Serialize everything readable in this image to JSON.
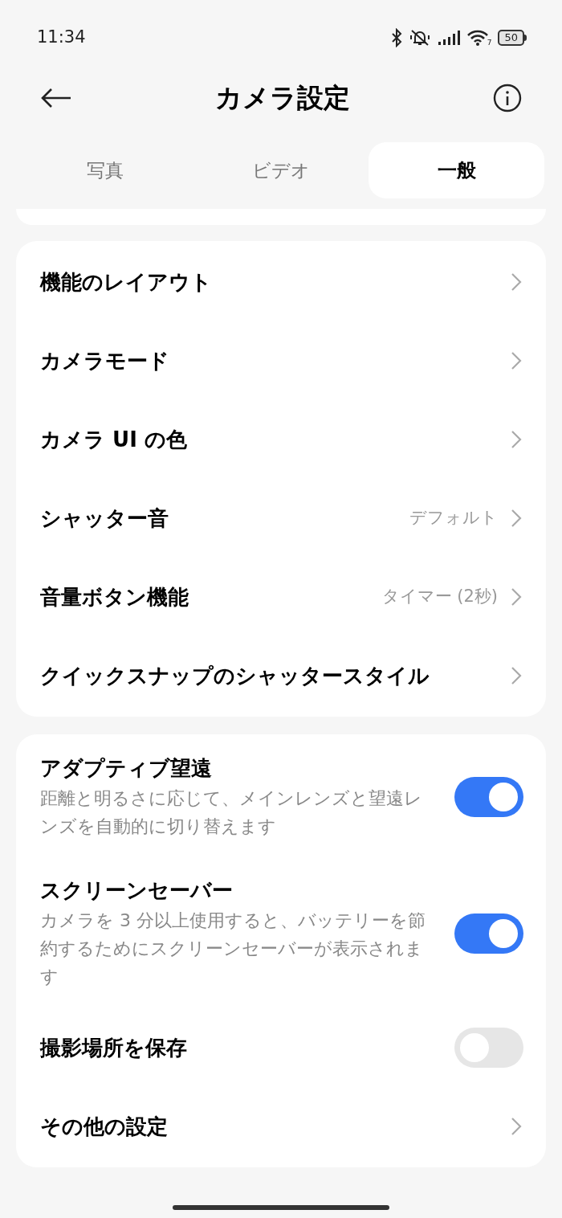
{
  "status_bar": {
    "time": "11:34",
    "wifi_badge": "7",
    "battery": "50"
  },
  "header": {
    "title": "カメラ設定"
  },
  "tabs": [
    {
      "label": "写真",
      "selected": false
    },
    {
      "label": "ビデオ",
      "selected": false
    },
    {
      "label": "一般",
      "selected": true
    }
  ],
  "groups": [
    {
      "items": [
        {
          "kind": "link",
          "label": "機能のレイアウト"
        },
        {
          "kind": "link",
          "label": "カメラモード"
        },
        {
          "kind": "link",
          "label": "カメラ UI の色"
        },
        {
          "kind": "link",
          "label": "シャッター音",
          "value": "デフォルト"
        },
        {
          "kind": "link",
          "label": "音量ボタン機能",
          "value": "タイマー (2秒)"
        },
        {
          "kind": "link",
          "label": "クイックスナップのシャッタースタイル"
        }
      ]
    },
    {
      "items": [
        {
          "kind": "toggle",
          "label": "アダプティブ望遠",
          "description": "距離と明るさに応じて、メインレンズと望遠レンズを自動的に切り替えます",
          "on": true
        },
        {
          "kind": "toggle",
          "label": "スクリーンセーバー",
          "description": "カメラを 3 分以上使用すると、バッテリーを節約するためにスクリーンセーバーが表示されます",
          "on": true
        },
        {
          "kind": "toggle",
          "label": "撮影場所を保存",
          "on": false
        },
        {
          "kind": "link",
          "label": "その他の設定"
        }
      ]
    }
  ]
}
